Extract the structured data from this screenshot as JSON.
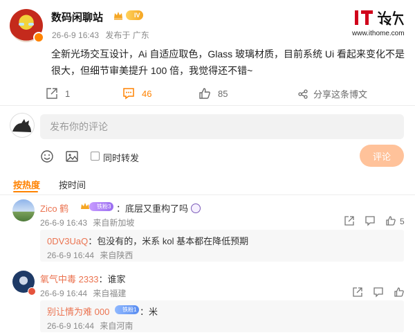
{
  "post": {
    "author": "数码闲聊站",
    "level_badge": "IV",
    "date": "26-6-9 16:43",
    "source": "发布于 广东",
    "text": "全新光场交互设计，Ai 自适应取色，Glass 玻璃材质，目前系统 Ui 看起来变化不是很大，但细节审美提升 100 倍，我觉得还不错~"
  },
  "watermark": {
    "logo_text": "IT之家",
    "url": "www.ithome.com"
  },
  "actions": {
    "repost_count": "1",
    "comment_count": "46",
    "like_count": "85",
    "share_label": "分享这条博文",
    "comments_color": "#ff8200"
  },
  "composer": {
    "placeholder": "发布你的评论",
    "repost_label": "同时转发",
    "submit_label": "评论"
  },
  "sort": {
    "hot": "按热度",
    "time": "按时间"
  },
  "comments": [
    {
      "name": "Zico 鹤",
      "badge": "铁粉3",
      "text": "：底层又重构了吗",
      "date": "26-6-9 16:43",
      "location": "来自新加坡",
      "likes": "5",
      "reply": {
        "name": "0DV3UaQ",
        "text": "：包没有的，米系 kol 基本都在降低预期",
        "date": "26-6-9 16:44",
        "location": "来自陕西"
      }
    },
    {
      "name": "氧气中毒 2333",
      "text": "：谁家",
      "date": "26-6-9 16:44",
      "location": "来自福建",
      "likes": "",
      "reply": {
        "name": "别让情为难 000",
        "badge": "铁粉1",
        "text": "：米",
        "date": "26-6-9 16:44",
        "location": "来自河南"
      }
    }
  ],
  "icons": {
    "repost": "repost-icon",
    "comment": "comment-icon",
    "like": "thumb-up-icon",
    "share": "share-icon",
    "emoji": "smiley-icon",
    "image": "image-icon",
    "crown": "crown-icon"
  }
}
